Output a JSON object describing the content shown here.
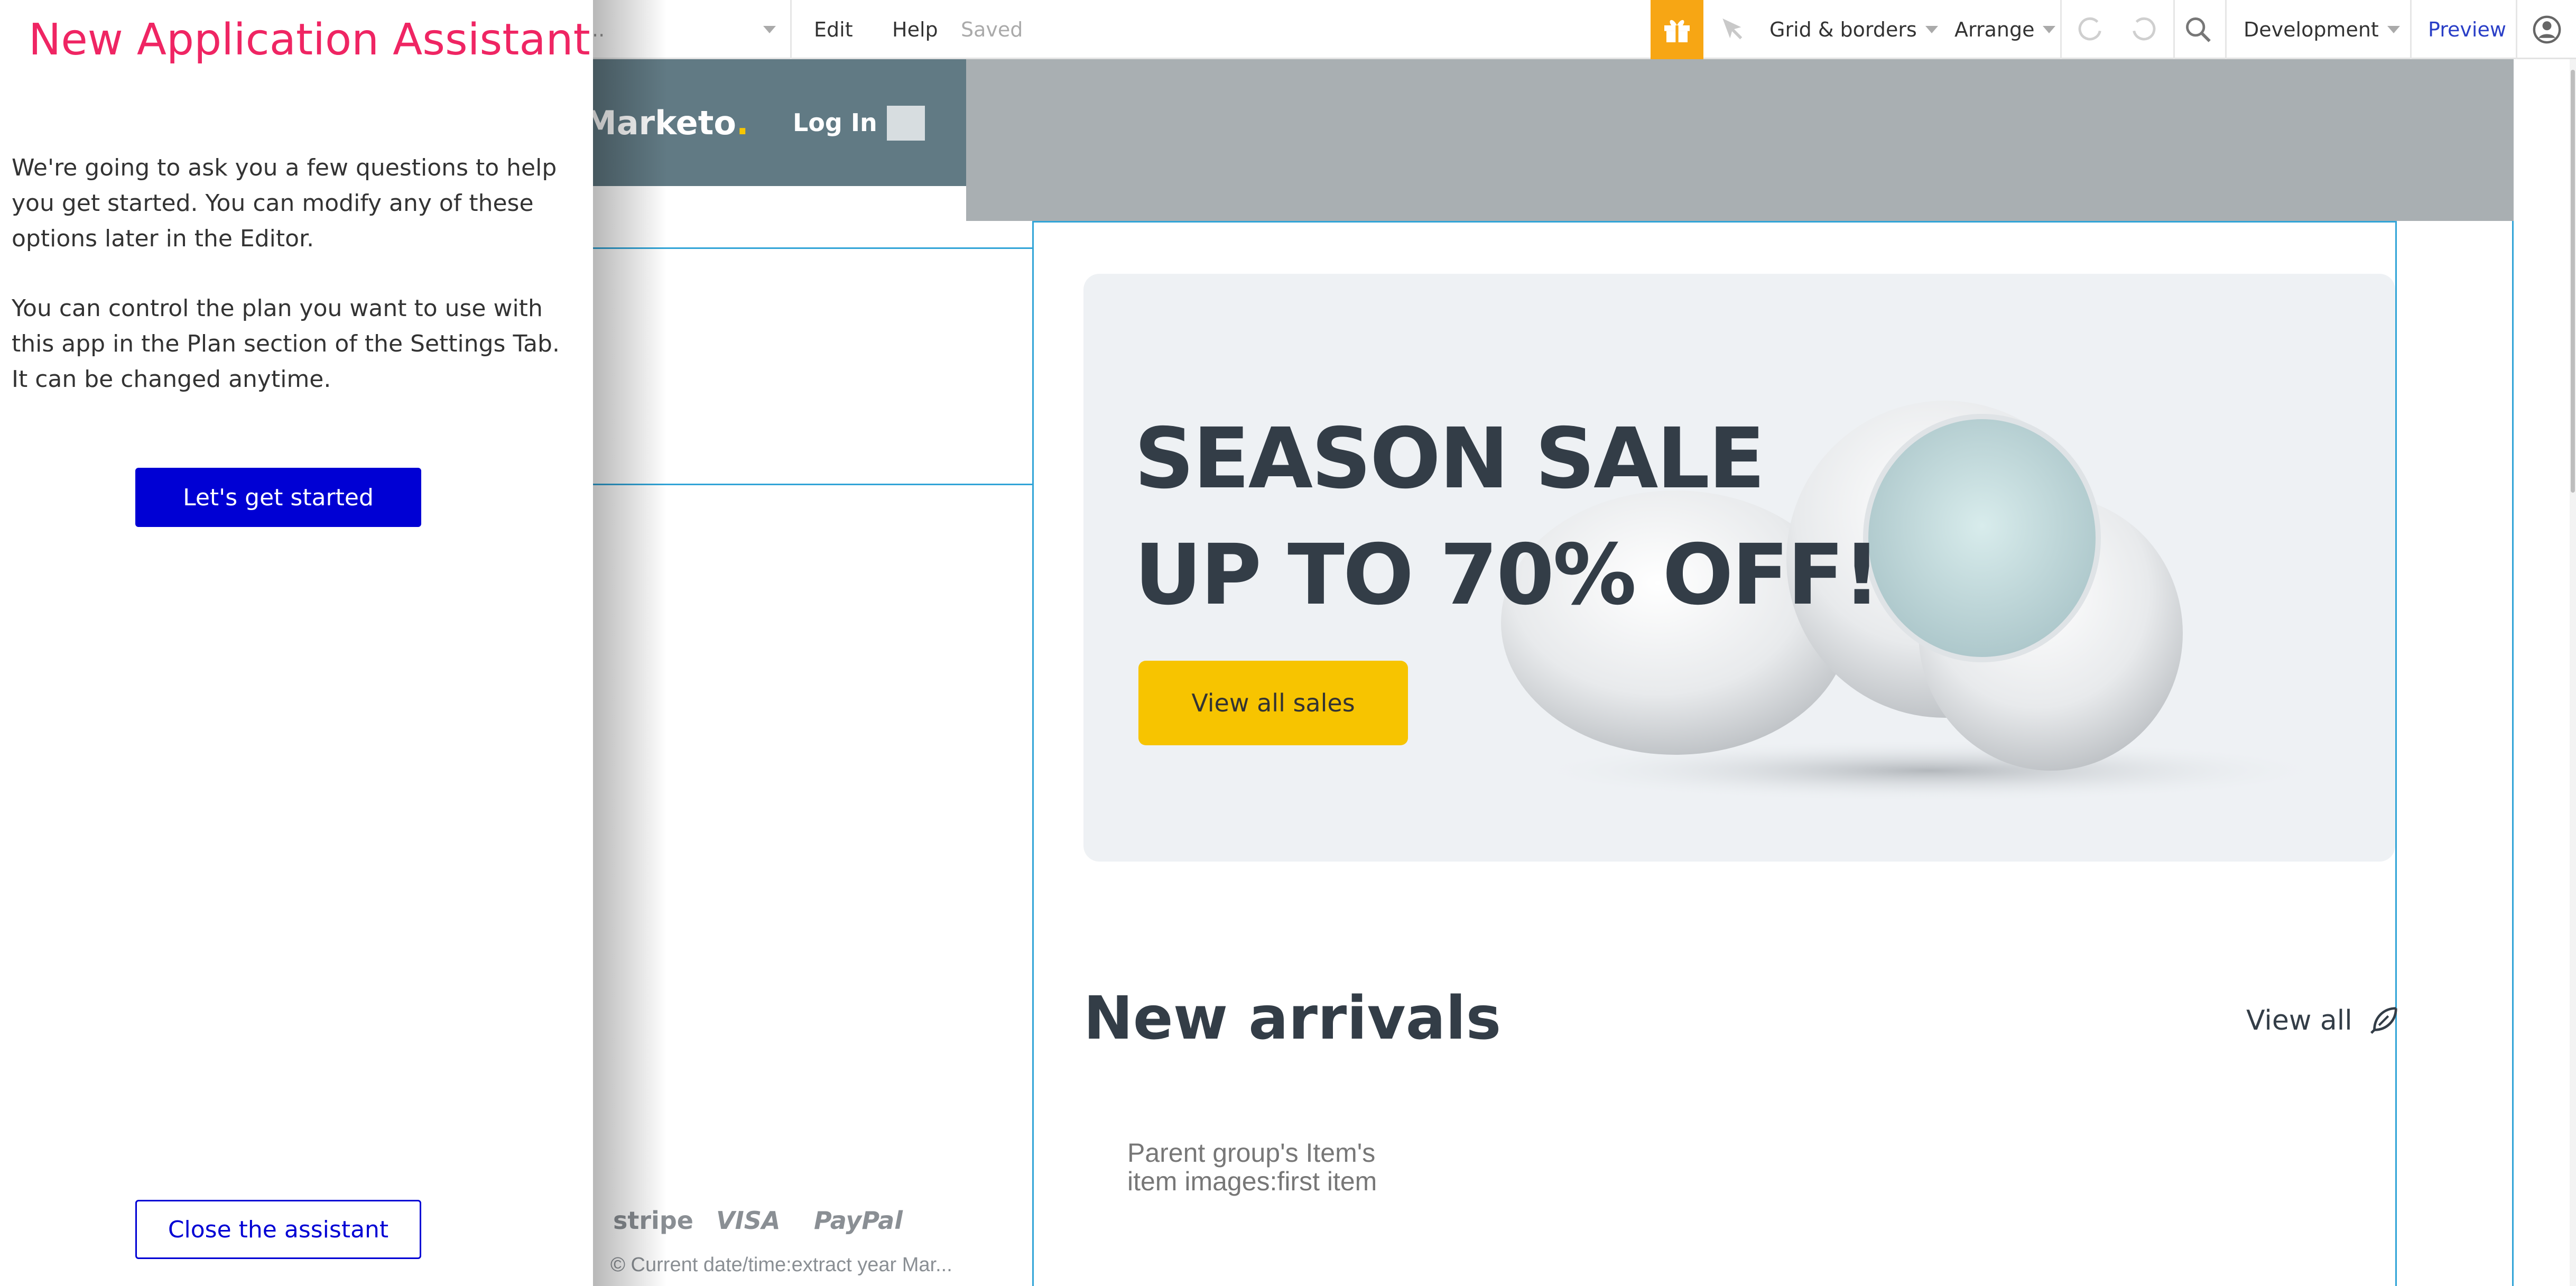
{
  "toolbar": {
    "page_selector_value": "..",
    "edit": "Edit",
    "help": "Help",
    "status": "Saved",
    "grid_borders": "Grid & borders",
    "arrange": "Arrange",
    "environment": "Development",
    "preview": "Preview",
    "icons": [
      "gift-icon",
      "pointer-icon",
      "undo-icon",
      "redo-icon",
      "search-icon",
      "user-icon"
    ],
    "gift_color": "#f7a614",
    "preview_color": "#2a3fc7"
  },
  "canvas": {
    "brand_name": "Marketo",
    "brand_dot": ".",
    "login": "Log In",
    "hero": {
      "line1": "SEASON SALE",
      "line2": "UP TO 70% OFF!",
      "button": "View all sales"
    },
    "new_arrivals_title": "New arrivals",
    "view_all": "View all",
    "item_placeholder_line1": "Parent group's Item's",
    "item_placeholder_line2": "item  images:first item",
    "payment_logos": [
      "stripe",
      "VISA",
      "PayPal"
    ],
    "copyright": "© Current date/time:extract year Mar..."
  },
  "assistant": {
    "title": "New Application Assistant",
    "paragraph1": "We're going to ask you a few questions to help you get started. You can modify any of these options later in the Editor.",
    "paragraph2": "You can control the plan you want to use with this app in the Plan section of the Settings Tab. It can be changed anytime.",
    "start_button": "Let's get started",
    "close_button": "Close the assistant",
    "title_color": "#ef2563",
    "button_color": "#0000d4"
  }
}
